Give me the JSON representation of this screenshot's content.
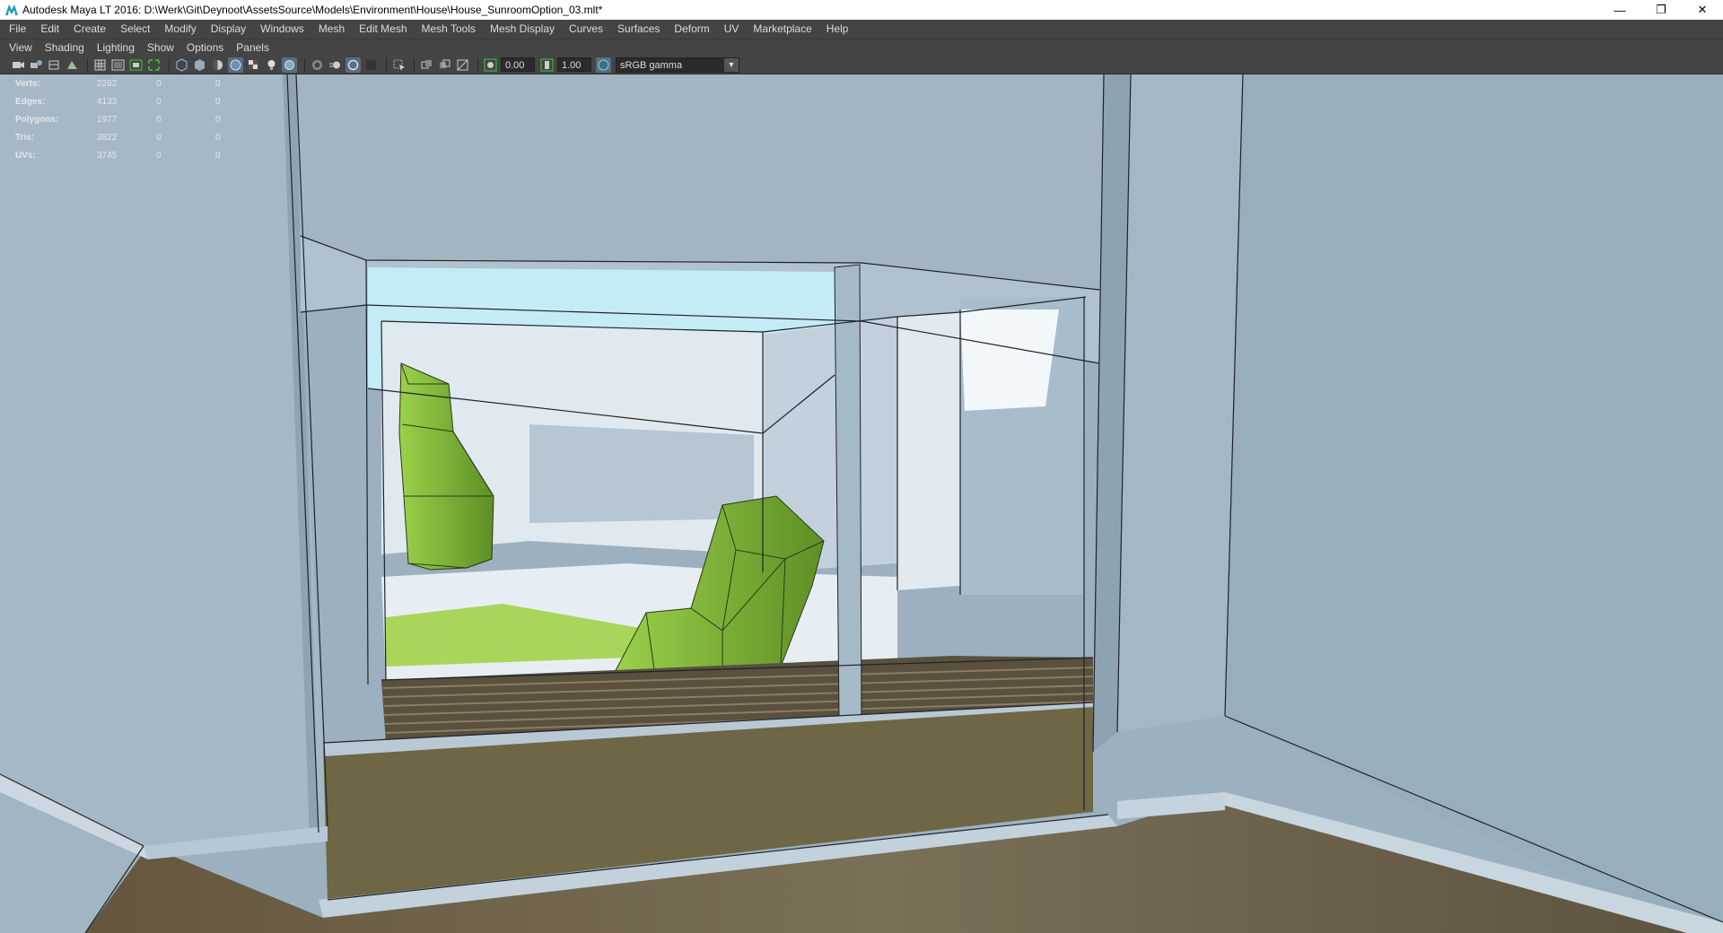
{
  "window": {
    "title": "Autodesk Maya LT 2016: D:\\Werk\\Git\\Deynoot\\AssetsSource\\Models\\Environment\\House\\House_SunroomOption_03.mlt*",
    "minimize": "—",
    "maximize": "❐",
    "close": "✕"
  },
  "menubar": [
    "File",
    "Edit",
    "Create",
    "Select",
    "Modify",
    "Display",
    "Windows",
    "Mesh",
    "Edit Mesh",
    "Mesh Tools",
    "Mesh Display",
    "Curves",
    "Surfaces",
    "Deform",
    "UV",
    "Marketplace",
    "Help"
  ],
  "panel_menu": [
    "View",
    "Shading",
    "Lighting",
    "Show",
    "Options",
    "Panels"
  ],
  "toolbar": {
    "exposure_value": "0.00",
    "gamma_value": "1.00",
    "color_space": "sRGB gamma"
  },
  "hud": {
    "rows": [
      {
        "label": "Verts:",
        "v1": "2262",
        "v2": "0",
        "v3": "0"
      },
      {
        "label": "Edges:",
        "v1": "4133",
        "v2": "0",
        "v3": "0"
      },
      {
        "label": "Polygons:",
        "v1": "1977",
        "v2": "0",
        "v3": "0"
      },
      {
        "label": "Tris:",
        "v1": "3822",
        "v2": "0",
        "v3": "0"
      },
      {
        "label": "UVs:",
        "v1": "3745",
        "v2": "0",
        "v3": "0"
      }
    ]
  },
  "colors": {
    "wall": "#9fb2c2",
    "floor": "#6e6347",
    "deck": "#5a4e3a",
    "plant": "#7aa83a",
    "sky": "#bfe9f5"
  }
}
